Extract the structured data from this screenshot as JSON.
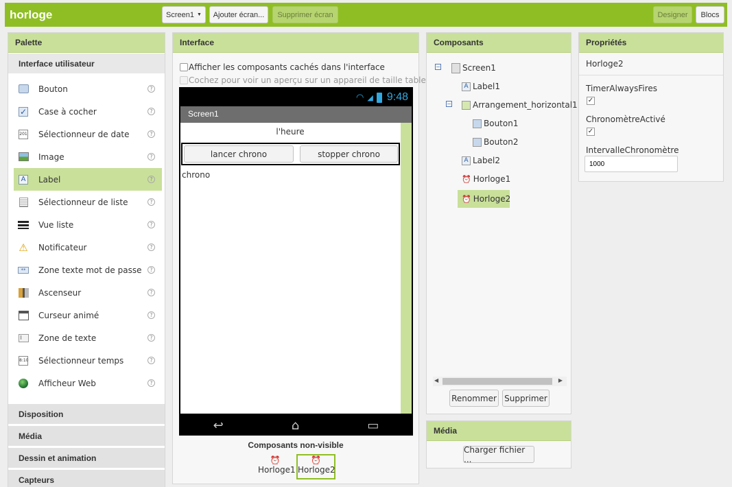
{
  "app": {
    "title": "horloge"
  },
  "toolbar": {
    "screen_select": "Screen1",
    "add_screen": "Ajouter écran...",
    "remove_screen": "Supprimer écran",
    "designer": "Designer",
    "blocks": "Blocs"
  },
  "palette": {
    "title": "Palette",
    "active_section": "Interface utilisateur",
    "items": [
      {
        "label": "Bouton",
        "icon": "button-icon"
      },
      {
        "label": "Case à cocher",
        "icon": "checkbox-icon"
      },
      {
        "label": "Sélectionneur de date",
        "icon": "date-picker-icon"
      },
      {
        "label": "Image",
        "icon": "image-icon"
      },
      {
        "label": "Label",
        "icon": "label-icon"
      },
      {
        "label": "Sélectionneur de liste",
        "icon": "list-picker-icon"
      },
      {
        "label": "Vue liste",
        "icon": "list-view-icon"
      },
      {
        "label": "Notificateur",
        "icon": "notifier-icon"
      },
      {
        "label": "Zone texte mot de passe",
        "icon": "password-icon"
      },
      {
        "label": "Ascenseur",
        "icon": "slider-icon"
      },
      {
        "label": "Curseur animé",
        "icon": "spinner-icon"
      },
      {
        "label": "Zone de texte",
        "icon": "textbox-icon"
      },
      {
        "label": "Sélectionneur temps",
        "icon": "time-picker-icon"
      },
      {
        "label": "Afficheur Web",
        "icon": "web-viewer-icon"
      }
    ],
    "selected_index": 4,
    "sections": [
      "Disposition",
      "Média",
      "Dessin et animation",
      "Capteurs"
    ]
  },
  "viewer": {
    "title": "Interface",
    "show_hidden": "Afficher les composants cachés dans l'interface",
    "tablet_preview": "Cochez pour voir un aperçu sur un appareil de taille tablette.",
    "status_time": "9:48",
    "screen_title": "Screen1",
    "label1": "l'heure",
    "button1": "lancer chrono",
    "button2": "stopper chrono",
    "label2": "chrono",
    "non_visible_title": "Composants non-visible",
    "non_visible": [
      "Horloge1",
      "Horloge2"
    ]
  },
  "components": {
    "title": "Composants",
    "tree": [
      "Screen1",
      "Label1",
      "Arrangement_horizontal1",
      "Bouton1",
      "Bouton2",
      "Label2",
      "Horloge1",
      "Horloge2"
    ],
    "rename": "Renommer",
    "delete": "Supprimer"
  },
  "media": {
    "title": "Média",
    "upload": "Charger fichier ..."
  },
  "properties": {
    "title": "Propriétés",
    "component": "Horloge2",
    "timer_always_fires": "TimerAlwaysFires",
    "timer_enabled": "ChronomètreActivé",
    "timer_interval": "IntervalleChronomètre",
    "timer_interval_value": "1000"
  },
  "colors": {
    "brand": "#8fbe24",
    "header": "#c9e09a",
    "selected": "#c9e09a"
  }
}
